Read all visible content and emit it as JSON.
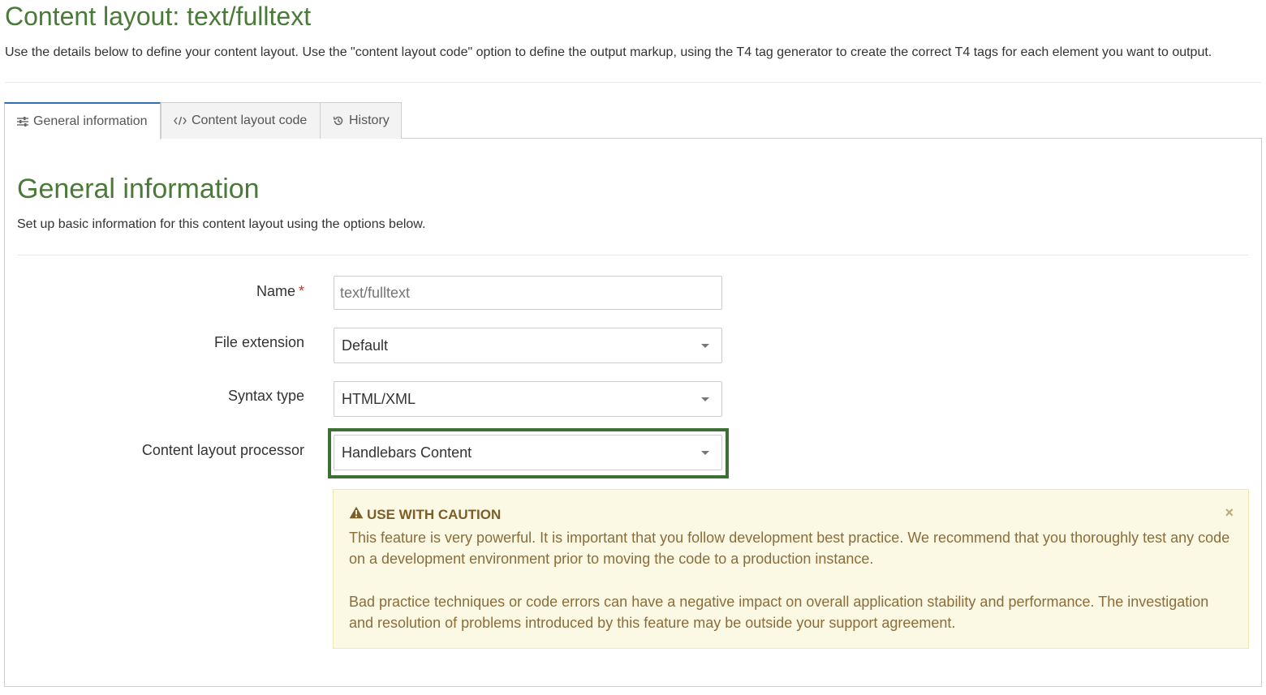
{
  "page": {
    "title": "Content layout: text/fulltext",
    "description": "Use the details below to define your content layout. Use the \"content layout code\" option to define the output markup, using the T4 tag generator to create the correct T4 tags for each element you want to output."
  },
  "tabs": [
    {
      "label": "General information",
      "icon": "sliders-icon",
      "active": true
    },
    {
      "label": "Content layout code",
      "icon": "code-icon",
      "active": false
    },
    {
      "label": "History",
      "icon": "history-icon",
      "active": false
    }
  ],
  "section": {
    "title": "General information",
    "description": "Set up basic information for this content layout using the options below."
  },
  "form": {
    "name": {
      "label": "Name",
      "required_mark": "*",
      "placeholder": "text/fulltext",
      "value": ""
    },
    "file_extension": {
      "label": "File extension",
      "value": "Default"
    },
    "syntax_type": {
      "label": "Syntax type",
      "value": "HTML/XML"
    },
    "processor": {
      "label": "Content layout processor",
      "value": "Handlebars Content"
    }
  },
  "alert": {
    "icon": "warning-icon",
    "title": "USE WITH CAUTION",
    "paragraph1": "This feature is very powerful. It is important that you follow development best practice. We recommend that you thoroughly test any code on a development environment prior to moving the code to a production instance.",
    "paragraph2": "Bad practice techniques or code errors can have a negative impact on overall application stability and performance. The investigation and resolution of problems introduced by this feature may be outside your support agreement.",
    "close": "×"
  },
  "colors": {
    "title_green": "#4a7a38",
    "highlight_green": "#3d7035",
    "alert_bg": "#fbf8e3",
    "alert_text": "#8a6d3b",
    "tab_active_border": "#2f6fb5"
  }
}
